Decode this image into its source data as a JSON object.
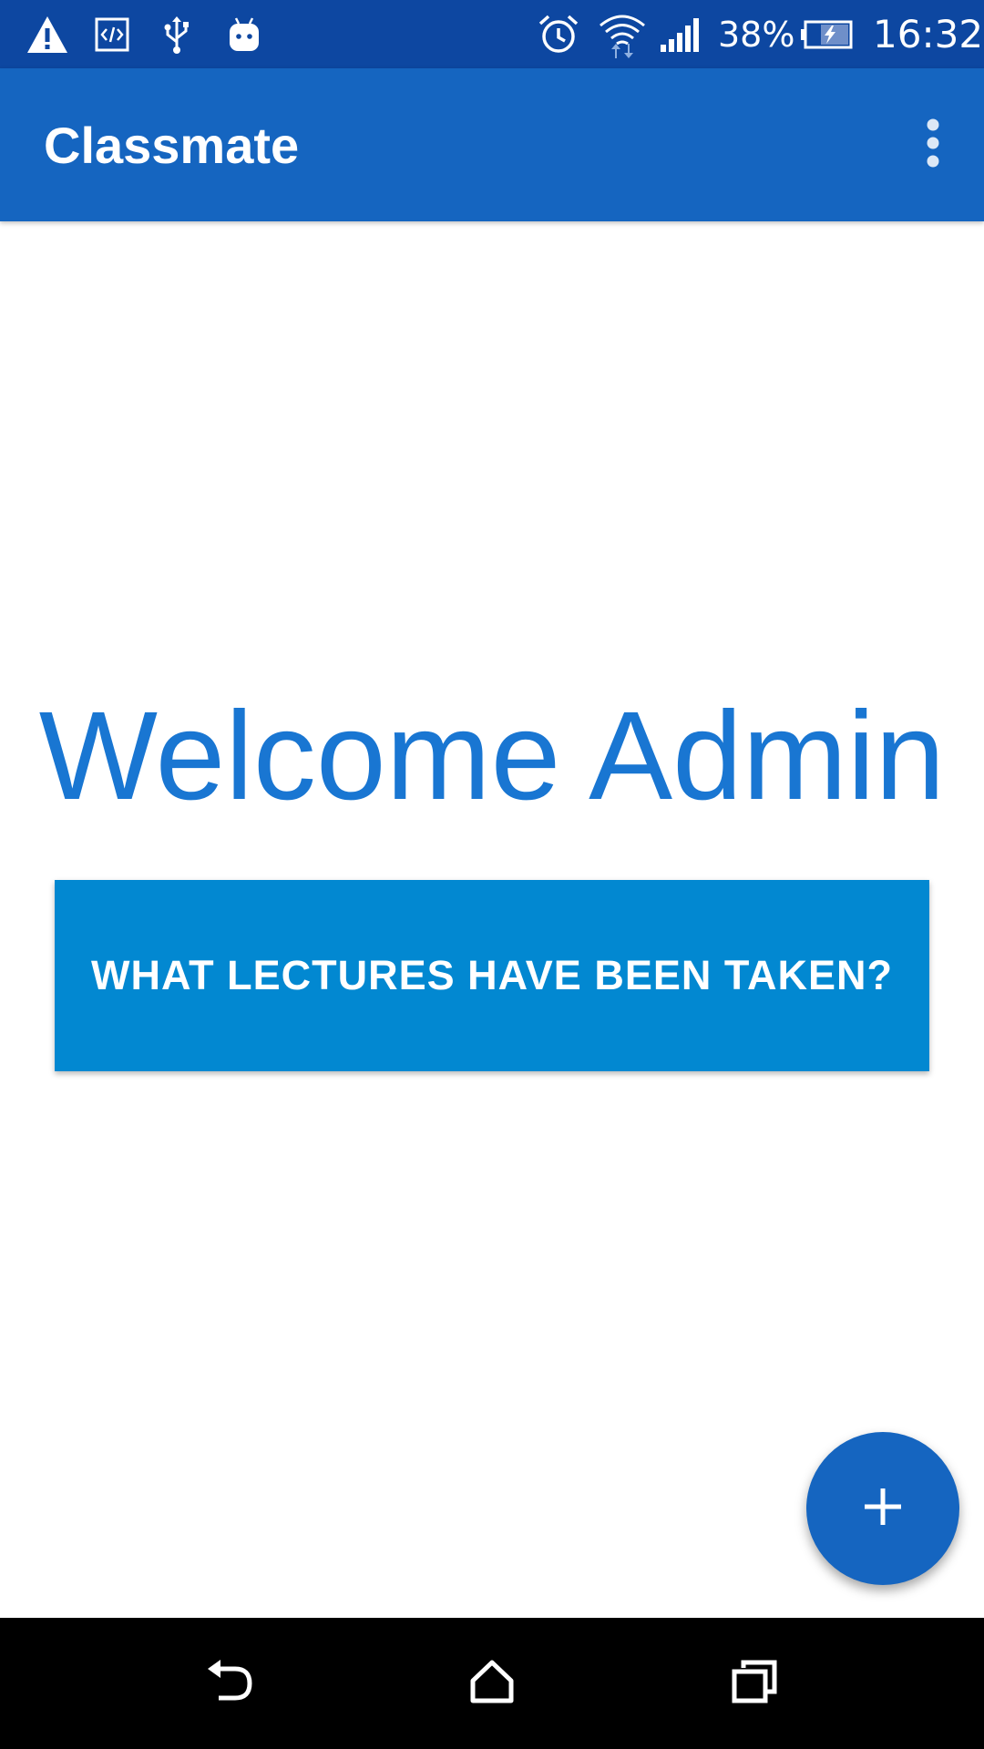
{
  "status_bar": {
    "battery_percent": "38%",
    "time": "16:32",
    "icons": [
      "warning-icon",
      "developer-code-icon",
      "usb-icon",
      "android-debug-icon",
      "alarm-icon",
      "wifi-icon",
      "signal-icon",
      "battery-charging-icon"
    ]
  },
  "app_bar": {
    "title": "Classmate",
    "menu_icon": "overflow-menu-icon"
  },
  "main": {
    "welcome_text": "Welcome Admin",
    "lectures_button_label": "WHAT LECTURES HAVE BEEN TAKEN?"
  },
  "fab": {
    "icon": "plus-icon"
  },
  "nav_bar": {
    "buttons": [
      "back-icon",
      "home-icon",
      "recents-icon"
    ]
  },
  "colors": {
    "status_bar": "#0D47A1",
    "app_bar": "#1565C0",
    "welcome_text": "#1976D2",
    "button": "#0288D1",
    "fab": "#1565C0",
    "nav_bar": "#000000"
  }
}
